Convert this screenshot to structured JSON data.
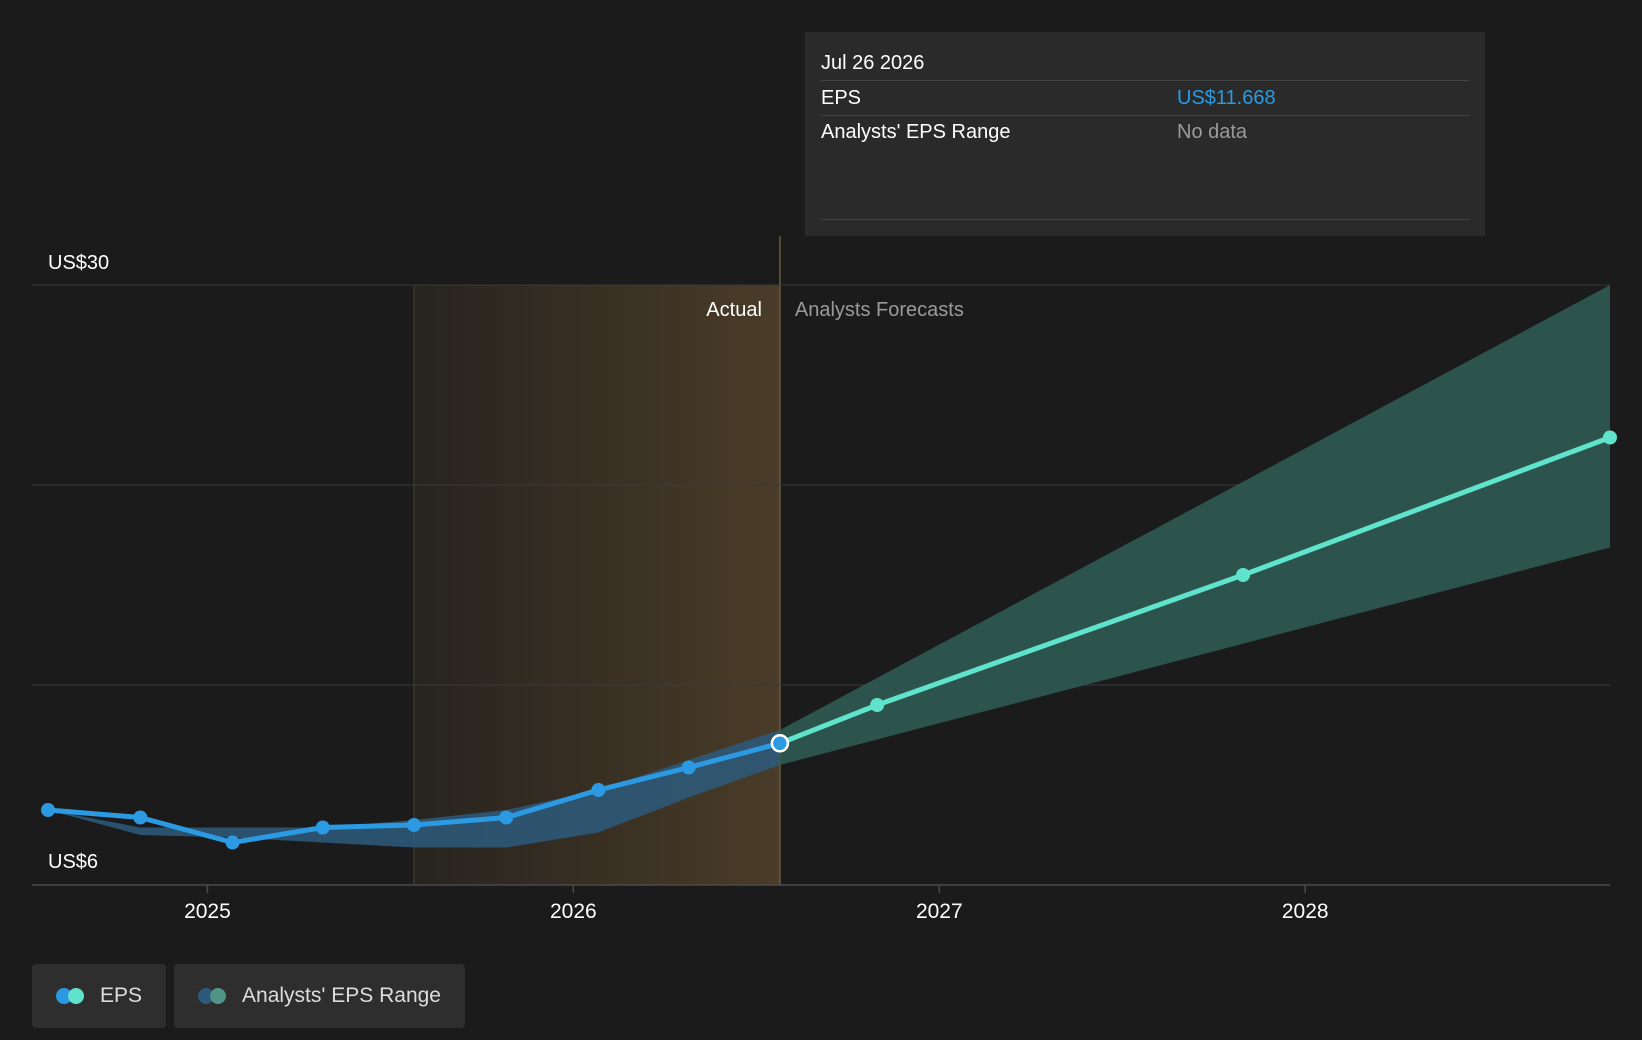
{
  "tooltip": {
    "date": "Jul 26 2026",
    "eps_label": "EPS",
    "eps_value": "US$11.668",
    "range_label": "Analysts' EPS Range",
    "range_value": "No data"
  },
  "legend": {
    "eps_label": "EPS",
    "range_label": "Analysts' EPS Range"
  },
  "colors": {
    "background": "#1b1b1b",
    "eps_actual": "#2b9ae3",
    "eps_forecast": "#5fe3cc",
    "range_actual": "#2d5a7c",
    "range_forecast": "#2f5a52",
    "actual_band": "#4a3c28",
    "tooltip_value": "#2b9ae3",
    "muted_text": "#9a9a9a"
  },
  "chart_data": {
    "type": "line",
    "y_axis": {
      "ylim": [
        6,
        30
      ],
      "tick_labels": [
        "US$30",
        "US$6"
      ]
    },
    "x_axis": {
      "tick_labels": [
        "2025",
        "2026",
        "2027",
        "2028"
      ],
      "tick_dates": [
        "2025-01-01",
        "2026-01-01",
        "2027-01-01",
        "2028-01-01"
      ],
      "range": [
        "2024-07-10",
        "2028-10-31"
      ]
    },
    "regions": {
      "actual_label": "Actual",
      "forecast_label": "Analysts Forecasts",
      "actual_band_start": "2025-07-26",
      "divider_date": "2026-07-26"
    },
    "series": [
      {
        "name": "EPS",
        "segment": "actual",
        "points": [
          {
            "x": "2024-07-26",
            "y": 9.0
          },
          {
            "x": "2024-10-26",
            "y": 8.7
          },
          {
            "x": "2025-01-26",
            "y": 7.7
          },
          {
            "x": "2025-04-26",
            "y": 8.3
          },
          {
            "x": "2025-07-26",
            "y": 8.4
          },
          {
            "x": "2025-10-26",
            "y": 8.7
          },
          {
            "x": "2026-01-26",
            "y": 9.8
          },
          {
            "x": "2026-04-26",
            "y": 10.7
          },
          {
            "x": "2026-07-26",
            "y": 11.668
          }
        ]
      },
      {
        "name": "EPS",
        "segment": "forecast",
        "points": [
          {
            "x": "2026-07-26",
            "y": 11.668
          },
          {
            "x": "2026-10-31",
            "y": 13.2
          },
          {
            "x": "2027-10-31",
            "y": 18.4
          },
          {
            "x": "2028-10-31",
            "y": 23.9
          }
        ]
      }
    ],
    "range_band": {
      "name": "Analysts' EPS Range",
      "points": [
        {
          "x": "2024-07-26",
          "low": 9.0,
          "high": 9.0
        },
        {
          "x": "2024-10-26",
          "low": 8.0,
          "high": 8.3
        },
        {
          "x": "2025-01-26",
          "low": 7.9,
          "high": 8.3
        },
        {
          "x": "2025-04-26",
          "low": 7.7,
          "high": 8.3
        },
        {
          "x": "2025-07-26",
          "low": 7.5,
          "high": 8.6
        },
        {
          "x": "2025-10-26",
          "low": 7.5,
          "high": 9.0
        },
        {
          "x": "2026-01-26",
          "low": 8.1,
          "high": 9.8
        },
        {
          "x": "2026-04-26",
          "low": 9.5,
          "high": 11.0
        },
        {
          "x": "2026-07-26",
          "low": 10.8,
          "high": 12.2
        },
        {
          "x": "2028-10-31",
          "low": 19.5,
          "high": 30.0
        }
      ]
    },
    "grid": true,
    "legend_position": "bottom-left"
  }
}
